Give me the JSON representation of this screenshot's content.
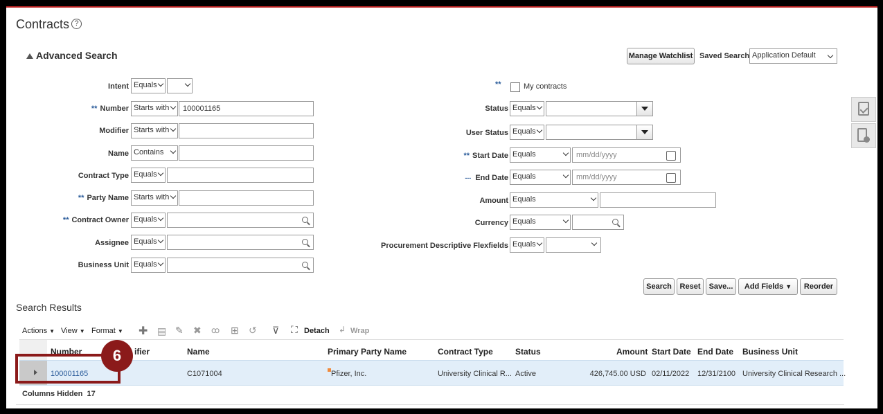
{
  "page": {
    "title": "Contracts",
    "help": "?"
  },
  "advanced_search": {
    "title": "Advanced Search",
    "manage_watchlist": "Manage Watchlist",
    "saved_search_label": "Saved Search",
    "saved_search_value": "Application Default",
    "required_marker": "**",
    "left_fields": [
      {
        "label": "Intent",
        "op": "Equals",
        "value": ""
      },
      {
        "label": "Number",
        "op": "Starts with",
        "value": "100001165"
      },
      {
        "label": "Modifier",
        "op": "Starts with",
        "value": ""
      },
      {
        "label": "Name",
        "op": "Contains",
        "value": ""
      },
      {
        "label": "Contract Type",
        "op": "Equals",
        "value": ""
      },
      {
        "label": "Party Name",
        "op": "Starts with",
        "value": ""
      },
      {
        "label": "Contract Owner",
        "op": "Equals",
        "value": ""
      },
      {
        "label": "Assignee",
        "op": "Equals",
        "value": ""
      },
      {
        "label": "Business Unit",
        "op": "Equals",
        "value": ""
      }
    ],
    "my_contracts": "My contracts",
    "right_fields": [
      {
        "label": "Status",
        "op": "Equals",
        "value": ""
      },
      {
        "label": "User Status",
        "op": "Equals",
        "value": ""
      },
      {
        "label": "Start Date",
        "op": "Equals",
        "placeholder": "mm/dd/yyyy"
      },
      {
        "label": "End Date",
        "op": "Equals",
        "placeholder": "mm/dd/yyyy"
      },
      {
        "label": "Amount",
        "op": "Equals",
        "value": ""
      },
      {
        "label": "Currency",
        "op": "Equals",
        "value": ""
      },
      {
        "label": "Procurement Descriptive Flexfields",
        "op": "Equals",
        "value": ""
      }
    ],
    "end_date_marker": "---",
    "buttons": {
      "search": "Search",
      "reset": "Reset",
      "save": "Save...",
      "add_fields": "Add Fields",
      "reorder": "Reorder"
    }
  },
  "results": {
    "title": "Search Results",
    "toolbar": {
      "actions": "Actions",
      "view": "View",
      "format": "Format",
      "detach": "Detach",
      "wrap": "Wrap"
    },
    "columns": [
      "Number",
      "ifier",
      "Name",
      "Primary Party Name",
      "Contract Type",
      "Status",
      "Amount",
      "Start Date",
      "End Date",
      "Business Unit"
    ],
    "row": {
      "number": "100001165",
      "name": "C1071004",
      "party": "Pfizer, Inc.",
      "contract_type": "University Clinical R...",
      "status": "Active",
      "amount": "426,745.00 USD",
      "start_date": "02/11/2022",
      "end_date": "12/31/2100",
      "business_unit": "University Clinical Research ..."
    },
    "columns_hidden_label": "Columns Hidden",
    "columns_hidden_count": "17"
  },
  "callout": {
    "number": "6"
  },
  "colors": {
    "accent": "#2a5b9a",
    "callout": "#8b1a1a",
    "row_selected": "#e2eef9"
  }
}
